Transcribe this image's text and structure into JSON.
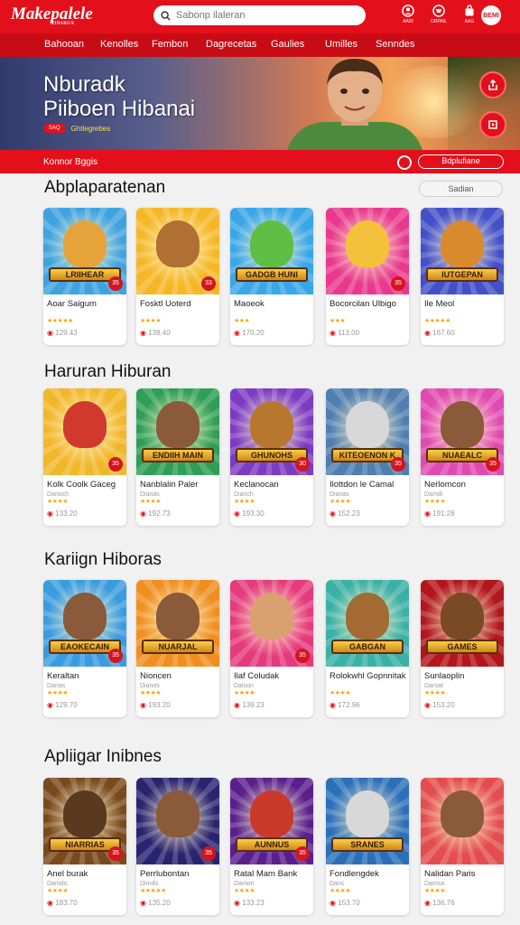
{
  "header": {
    "logo": "Makepalele",
    "logo_tag": "KIDSBOX",
    "search_placeholder": "Sabonp ilaleran",
    "icons": [
      {
        "name": "user-icon",
        "label": "AARI"
      },
      {
        "name": "cart-icon",
        "label": "ORPAIL"
      },
      {
        "name": "bag-icon",
        "label": "AAG"
      }
    ],
    "avatar_label": "BEMI"
  },
  "nav": [
    "Bahooan",
    "Kenolles",
    "Fembon",
    "Dagrecetas",
    "Gaulies",
    "Umilles",
    "Senndes"
  ],
  "hero": {
    "title_line1": "Nburadk",
    "title_line2": "Piiboen Hibanai",
    "pill": "SAQ",
    "tagline": "Ghtlegrebes"
  },
  "filter": {
    "label": "Konnor Bggis",
    "button": "Bdplufiane"
  },
  "sections": [
    {
      "title": "Abplaparatenan",
      "button": "Sadian",
      "cards": [
        {
          "name": "Aoar Saigum",
          "sub": "",
          "stars": "★★★★★",
          "price": "129.43",
          "banner": "LRIIHEAR",
          "badge": "35",
          "bg": "#3fa3e0",
          "fig": "#e6a33c"
        },
        {
          "name": "Fosktl Uoterd",
          "sub": "",
          "stars": "★★★★",
          "price": "138.40",
          "banner": "",
          "badge": "33",
          "bg": "#f5b726",
          "fig": "#b07033"
        },
        {
          "name": "Maoeok",
          "sub": "",
          "stars": "★★★",
          "price": "170.20",
          "banner": "GADGB HUNI",
          "badge": "",
          "bg": "#39a6e8",
          "fig": "#5fbf45"
        },
        {
          "name": "Bocorcilan Ulbigo",
          "sub": "",
          "stars": "★★★",
          "price": "113.00",
          "banner": "",
          "badge": "35",
          "bg": "#e8398e",
          "fig": "#f3c23a"
        },
        {
          "name": "Ile Meol",
          "sub": "",
          "stars": "★★★★★",
          "price": "167.60",
          "banner": "IUTGEPAN",
          "badge": "",
          "bg": "#4350c9",
          "fig": "#d98a2d"
        }
      ]
    },
    {
      "title": "Haruran Hiburan",
      "cards": [
        {
          "name": "Kolk Coolk Gaceg",
          "sub": "Darioch",
          "stars": "★★★★",
          "price": "133.20",
          "banner": "",
          "badge": "35",
          "bg": "#f1b72a",
          "fig": "#d0392c"
        },
        {
          "name": "Nanblalin Paler",
          "sub": "Dianas",
          "stars": "★★★★",
          "price": "192.73",
          "banner": "ENDIIH MAIN",
          "badge": "",
          "bg": "#2f9e56",
          "fig": "#8a5a3a"
        },
        {
          "name": "Keclanocan",
          "sub": "Dianch",
          "stars": "★★★★",
          "price": "193.30",
          "banner": "GHUNOHS",
          "badge": "30",
          "bg": "#7d3bc4",
          "fig": "#b8772f"
        },
        {
          "name": "Ilottdon le Camal",
          "sub": "Dianas",
          "stars": "★★★★",
          "price": "152.23",
          "banner": "KITEOENON K",
          "badge": "35",
          "bg": "#4f7eb0",
          "fig": "#d8d8d8"
        },
        {
          "name": "Nerlomcon",
          "sub": "Damdi",
          "stars": "★★★★",
          "price": "191.28",
          "banner": "NUAEALC",
          "badge": "35",
          "bg": "#e04ab0",
          "fig": "#8a5a3a"
        }
      ]
    },
    {
      "title": "Kariign Hiboras",
      "cards": [
        {
          "name": "Keraltan",
          "sub": "Darias",
          "stars": "★★★★",
          "price": "129.70",
          "banner": "EAOKECAIN",
          "badge": "35",
          "bg": "#3a9ce0",
          "fig": "#8a5a3a"
        },
        {
          "name": "Nioncen",
          "sub": "Dianos",
          "stars": "★★★★",
          "price": "193.20",
          "banner": "NUARJAL",
          "badge": "",
          "bg": "#f08f1f",
          "fig": "#8a5a3a"
        },
        {
          "name": "Ilaf Coludak",
          "sub": "Dalson",
          "stars": "★★★★",
          "price": "139.23",
          "banner": "",
          "badge": "35",
          "bg": "#e53a7c",
          "fig": "#d9a070"
        },
        {
          "name": "Rolokwhl Gopnnitak",
          "sub": "",
          "stars": "★★★★",
          "price": "172.96",
          "banner": "GABGAN",
          "badge": "",
          "bg": "#3bb0a6",
          "fig": "#a46a34"
        },
        {
          "name": "Sunlaoplin",
          "sub": "Daroat",
          "stars": "★★★★",
          "price": "153.20",
          "banner": "GAMES",
          "badge": "",
          "bg": "#b2161c",
          "fig": "#7a4a24"
        }
      ]
    },
    {
      "title": "Apliigar Inibnes",
      "cards": [
        {
          "name": "Anel burak",
          "sub": "Damdo",
          "stars": "★★★★",
          "price": "183.70",
          "banner": "NIARRIAS",
          "badge": "35",
          "bg": "#7a4a1c",
          "fig": "#5a3a1e"
        },
        {
          "name": "Perrlubontan",
          "sub": "Dimdo",
          "stars": "★★★★★",
          "price": "135.20",
          "banner": "",
          "badge": "35",
          "bg": "#2a2370",
          "fig": "#8a5a3a"
        },
        {
          "name": "Ratal Mam Bank",
          "sub": "Damon",
          "stars": "★★★★",
          "price": "133.23",
          "banner": "AUNNUS",
          "badge": "35",
          "bg": "#5a1f8c",
          "fig": "#c93a2a"
        },
        {
          "name": "Fondlengdek",
          "sub": "Danc",
          "stars": "★★★★",
          "price": "153.70",
          "banner": "SRANES",
          "badge": "",
          "bg": "#2b6fb8",
          "fig": "#d8d8d8"
        },
        {
          "name": "Nalidan Paris",
          "sub": "Damsa",
          "stars": "★★★★",
          "price": "136.76",
          "banner": "",
          "badge": "",
          "bg": "#e34d4d",
          "fig": "#8a5a3a"
        }
      ]
    }
  ]
}
